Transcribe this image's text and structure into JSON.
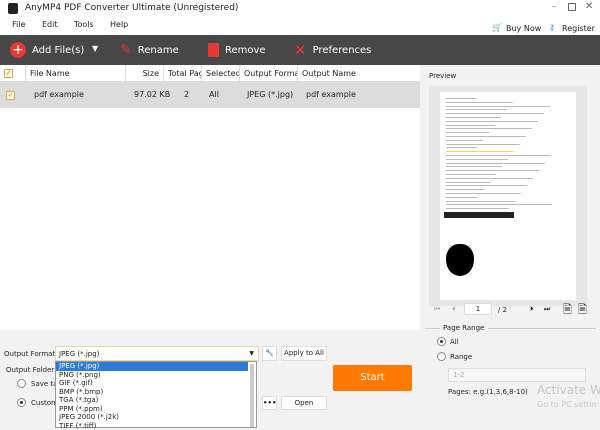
{
  "app": {
    "title": "AnyMP4 PDF Converter Ultimate (Unregistered)"
  },
  "menu": [
    "File",
    "Edit",
    "Tools",
    "Help"
  ],
  "top_links": {
    "buy": "Buy Now",
    "register": "Register"
  },
  "toolbar": {
    "add": "Add File(s)",
    "rename": "Rename",
    "remove": "Remove",
    "preferences": "Preferences"
  },
  "table": {
    "headers": [
      "File Name",
      "Size",
      "Total Pag",
      "Selected",
      "Output Forma",
      "Output Name"
    ],
    "rows": [
      {
        "name": "pdf example",
        "size": "97.02 KB",
        "pages": "2",
        "selected": "All",
        "format": "JPEG (*.jpg)",
        "output": "pdf example"
      }
    ]
  },
  "bottom": {
    "format_label": "Output Format:",
    "format_value": "JPEG (*.jpg)",
    "apply_all": "Apply to All",
    "folder_label": "Output Folder:",
    "save_target": "Save ta",
    "customize": "Customi",
    "open": "Open",
    "browse": "•••",
    "start": "Start",
    "format_options": [
      "JPEG (*.jpg)",
      "PNG (*.png)",
      "GIF (*.gif)",
      "BMP (*.bmp)",
      "TGA (*.tga)",
      "PPM (*.ppm)",
      "JPEG 2000 (*.j2k)",
      "TIFF (*.tiff)"
    ]
  },
  "preview": {
    "label": "Preview",
    "page": "1",
    "total": "/ 2",
    "range_title": "Page Range",
    "all": "All",
    "range": "Range",
    "range_placeholder": "1-2",
    "hint": "Pages: e.g.(1,3,6,8-10)"
  },
  "watermark": {
    "line1": "Activate Wi",
    "line2": "Go to PC settin"
  },
  "colors": {
    "toolbar": "#474747",
    "accent": "#ff7a00",
    "icon_red": "#e53935"
  }
}
